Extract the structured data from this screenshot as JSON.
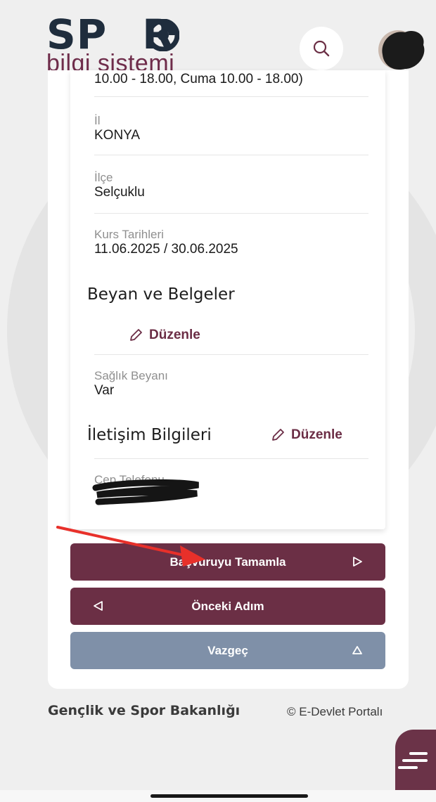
{
  "header": {
    "logo_title": "SP R",
    "logo_subtitle": "bilgi sistemi",
    "icons": {
      "search": "search-icon",
      "avatar": "avatar"
    }
  },
  "card": {
    "clipped_text": "10.00 - 18.00, Cuma 10.00 - 18.00)",
    "fields": {
      "province": {
        "label": "İl",
        "value": "KONYA"
      },
      "district": {
        "label": "İlçe",
        "value": "Selçuklu"
      },
      "course_dates": {
        "label": "Kurs Tarihleri",
        "value": "11.06.2025 / 30.06.2025"
      },
      "health": {
        "label": "Sağlık Beyanı",
        "value": "Var"
      },
      "phone": {
        "label": "Cep Telefonu"
      }
    },
    "sections": {
      "declarations": {
        "title": "Beyan ve Belgeler",
        "edit_label": "Düzenle"
      },
      "contact": {
        "title": "İletişim Bilgileri",
        "edit_label": "Düzenle"
      }
    }
  },
  "actions": {
    "complete": "Başvuruyu Tamamla",
    "previous": "Önceki Adım",
    "cancel": "Vazgeç"
  },
  "footer": {
    "ministry": "Gençlik ve Spor Bakanlığı",
    "copyright": "© E-Devlet Portalı"
  },
  "colors": {
    "primary": "#6b2f45",
    "cancel": "#7f90a8",
    "annotation_arrow": "#e8302a"
  }
}
